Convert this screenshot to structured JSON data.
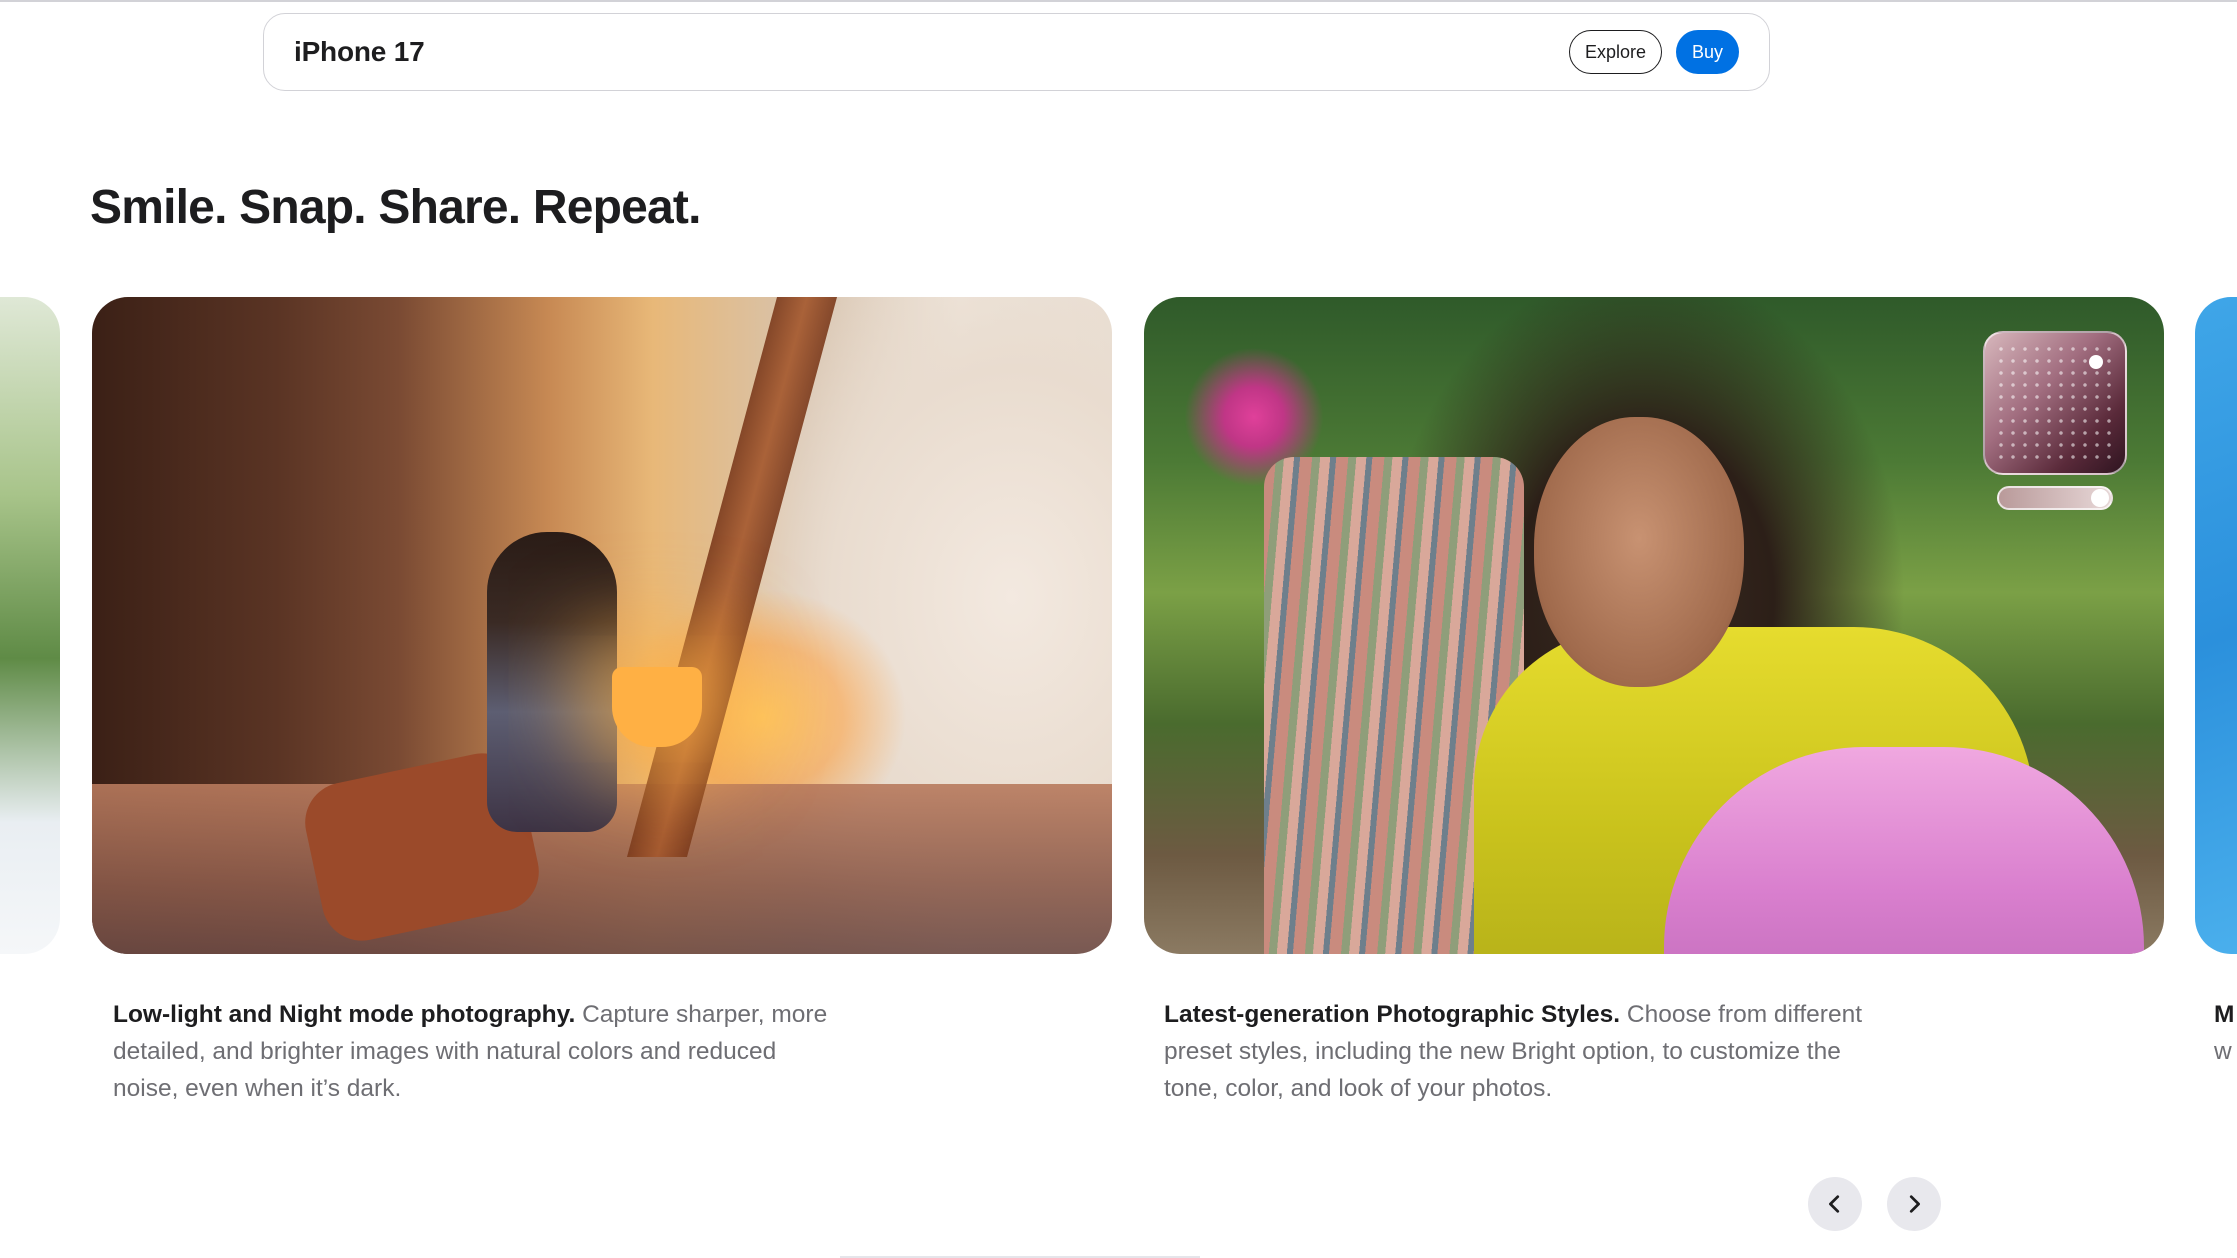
{
  "product_nav": {
    "title": "iPhone 17",
    "explore_label": "Explore",
    "buy_label": "Buy"
  },
  "section": {
    "headline": "Smile. Snap. Share. Repeat."
  },
  "gallery": {
    "cards": [
      {
        "lead": "Low-light and Night mode photography.",
        "body": "Capture sharper, more detailed, and brighter images with natural colors and reduced noise, even when it’s dark."
      },
      {
        "lead": "Latest-generation Photographic Styles.",
        "body": "Choose from different preset styles, including the new Bright option, to customize the tone, color, and look of your photos."
      }
    ],
    "next_card_peek": {
      "lead": "M",
      "body": "w"
    }
  },
  "controls": {
    "prev_icon": "chevron-left-icon",
    "next_icon": "chevron-right-icon"
  },
  "colors": {
    "accent": "#0071e3",
    "text_primary": "#1d1d1f",
    "text_secondary": "#6e6e73",
    "paddle_bg": "#e8e8ed"
  }
}
